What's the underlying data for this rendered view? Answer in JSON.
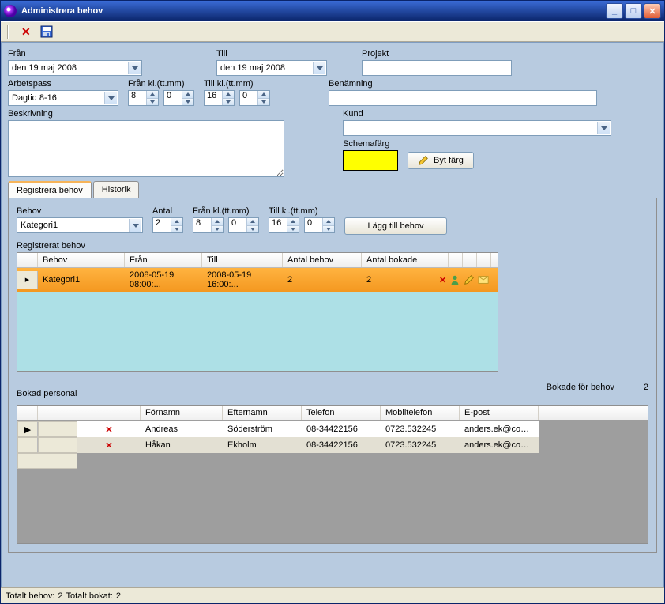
{
  "window": {
    "title": "Administrera behov"
  },
  "form": {
    "fran_label": "Från",
    "fran_value": "den 19    maj      2008",
    "till_label": "Till",
    "till_value": "den 19    maj      2008",
    "projekt_label": "Projekt",
    "projekt_value": "",
    "arbetspass_label": "Arbetspass",
    "arbetspass_value": "Dagtid 8-16",
    "fran_kl_label": "Från kl.(tt.mm)",
    "fran_kl_h": "8",
    "fran_kl_m": "0",
    "till_kl_label": "Till kl.(tt.mm)",
    "till_kl_h": "16",
    "till_kl_m": "0",
    "benamning_label": "Benämning",
    "benamning_value": "",
    "beskrivning_label": "Beskrivning",
    "beskrivning_value": "",
    "kund_label": "Kund",
    "kund_value": "",
    "schemafarg_label": "Schemafärg",
    "schemafarg_color": "#ffff00",
    "byt_farg_label": "Byt färg"
  },
  "tabs": {
    "registrera": "Registrera behov",
    "historik": "Historik"
  },
  "behov_form": {
    "behov_label": "Behov",
    "behov_value": "Kategori1",
    "antal_label": "Antal",
    "antal_value": "2",
    "fran_kl_label": "Från kl.(tt.mm)",
    "fran_kl_h": "8",
    "fran_kl_m": "0",
    "till_kl_label": "Till kl.(tt.mm)",
    "till_kl_h": "16",
    "till_kl_m": "0",
    "lagg_till_label": "Lägg till behov"
  },
  "registrerat": {
    "section_label": "Registrerat behov",
    "cols": {
      "behov": "Behov",
      "fran": "Från",
      "till": "Till",
      "antal_behov": "Antal behov",
      "antal_bokade": "Antal bokade"
    },
    "rows": [
      {
        "behov": "Kategori1",
        "fran": "2008-05-19 08:00:...",
        "till": "2008-05-19 16:00:...",
        "antal_behov": "2",
        "antal_bokade": "2"
      }
    ]
  },
  "personal": {
    "section_label": "Bokad personal",
    "bokade_label": "Bokade för behov",
    "bokade_count": "2",
    "cols": {
      "fornamn": "Förnamn",
      "efternamn": "Efternamn",
      "telefon": "Telefon",
      "mobil": "Mobiltelefon",
      "epost": "E-post"
    },
    "rows": [
      {
        "fornamn": "Andreas",
        "efternamn": "Söderström",
        "telefon": "08-34422156",
        "mobil": "0723.532245",
        "epost": "anders.ek@comh..."
      },
      {
        "fornamn": "Håkan",
        "efternamn": "Ekholm",
        "telefon": "08-34422156",
        "mobil": "0723.532245",
        "epost": "anders.ek@comh..."
      }
    ]
  },
  "status": {
    "totalt_behov_label": "Totalt behov:",
    "totalt_behov_value": "2",
    "totalt_bokat_label": "Totalt bokat:",
    "totalt_bokat_value": "2"
  }
}
